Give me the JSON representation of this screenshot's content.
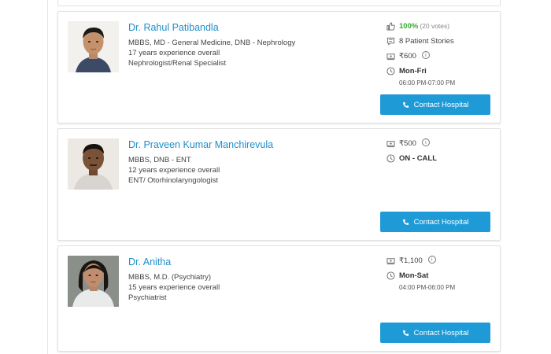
{
  "doctors": [
    {
      "name": "Dr. Rahul Patibandla",
      "qualifications": "MBBS, MD - General Medicine, DNB - Nephrology",
      "experience": "17 years experience overall",
      "specialty": "Nephrologist/Renal Specialist",
      "rating": "100%",
      "votes": "(20 votes)",
      "stories": "8 Patient Stories",
      "fee": "₹600",
      "availability": "Mon-Fri",
      "timing": "06:00 PM-07:00 PM",
      "contact_label": "Contact Hospital"
    },
    {
      "name": "Dr. Praveen Kumar Manchirevula",
      "qualifications": "MBBS, DNB - ENT",
      "experience": "12 years experience overall",
      "specialty": "ENT/ Otorhinolaryngologist",
      "fee": "₹500",
      "availability": "ON - CALL",
      "contact_label": "Contact Hospital"
    },
    {
      "name": "Dr. Anitha",
      "qualifications": "MBBS, M.D. (Psychiatry)",
      "experience": "15 years experience overall",
      "specialty": "Psychiatrist",
      "fee": "₹1,100",
      "availability": "Mon-Sat",
      "timing": "04:00 PM-06:00 PM",
      "contact_label": "Contact Hospital"
    }
  ],
  "icons": {
    "thumbs_up": "thumbs-up-icon",
    "stories": "chat-bubble-icon",
    "fee": "cash-icon",
    "clock": "clock-icon",
    "info": "info-icon",
    "phone": "phone-icon"
  },
  "colors": {
    "accent": "#1e9bd7",
    "name_link": "#1e8ec9",
    "rating_green": "#3aa835"
  }
}
